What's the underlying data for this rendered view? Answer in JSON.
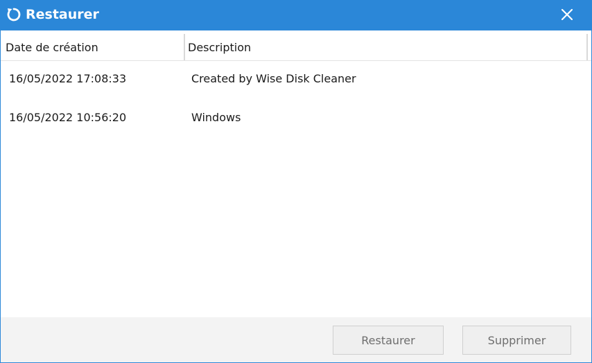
{
  "window": {
    "title": "Restaurer",
    "title_icon": "restore-icon",
    "close_icon": "close-icon",
    "accent_color": "#2b87d8"
  },
  "table": {
    "columns": [
      "Date de création",
      "Description"
    ],
    "rows": [
      {
        "date": "16/05/2022 17:08:33",
        "description": "Created by Wise Disk Cleaner"
      },
      {
        "date": "16/05/2022 10:56:20",
        "description": "Windows"
      }
    ]
  },
  "buttons": {
    "restore_label": "Restaurer",
    "delete_label": "Supprimer"
  }
}
